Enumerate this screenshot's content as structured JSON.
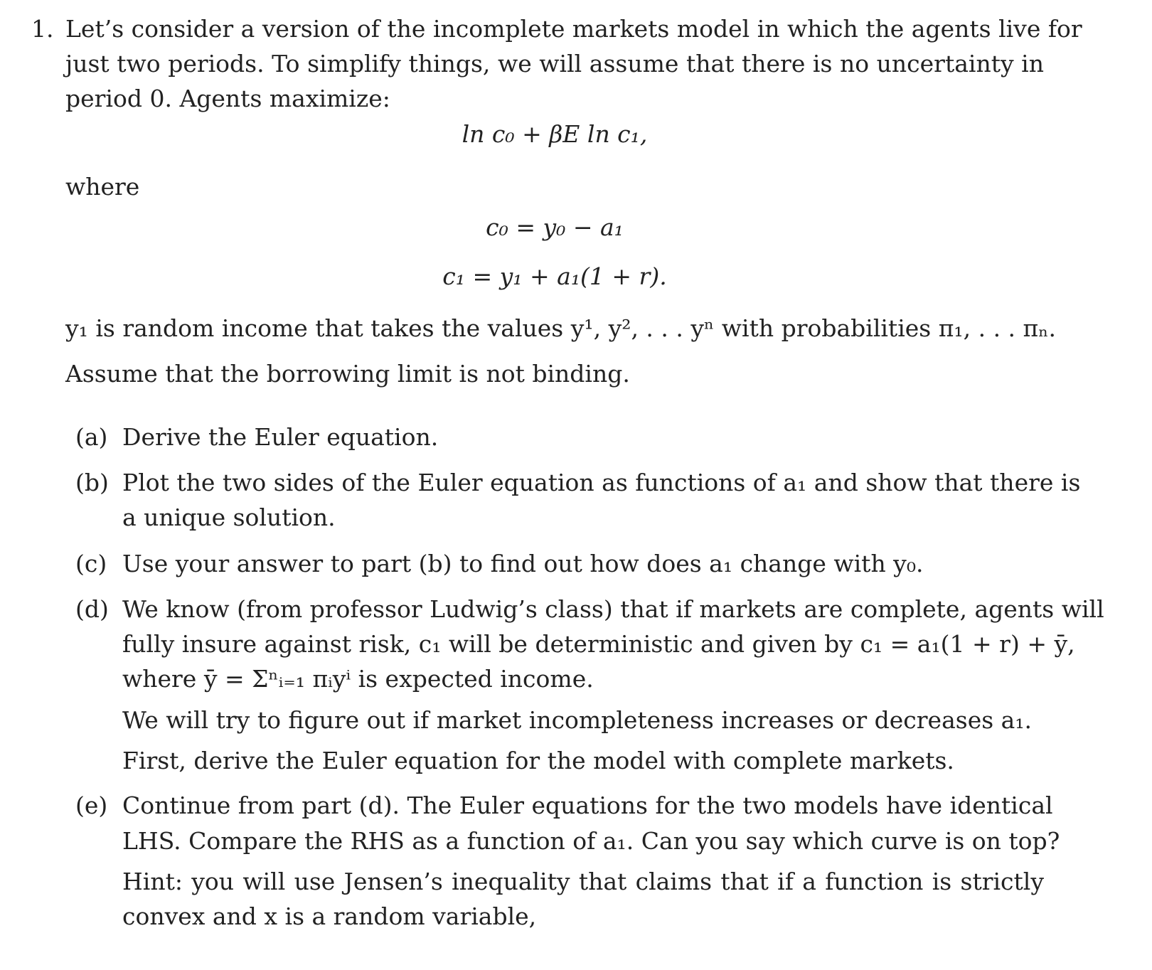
{
  "problem": {
    "number": "1.",
    "intro_lines": [
      "Let’s consider a version of the incomplete markets model in which the agents live for",
      "just two periods. To simplify things, we will assume that there is no uncertainty in",
      "period 0. Agents maximize:"
    ],
    "objective": "ln c₀ + βE ln c₁,",
    "where_label": "where",
    "constraint_1": "c₀ = y₀ − a₁",
    "constraint_2": "c₁ = y₁ + a₁(1 + r).",
    "income_line": "y₁ is random income that takes the values y¹, y², . . . yⁿ with probabilities π₁, . . . πₙ.",
    "assumption_line": "Assume that the borrowing limit is not binding."
  },
  "parts": [
    {
      "label": "(a)",
      "lines": [
        "Derive the Euler equation."
      ]
    },
    {
      "label": "(b)",
      "lines": [
        "Plot the two sides of the Euler equation as functions of a₁ and show that there is",
        "a unique solution."
      ]
    },
    {
      "label": "(c)",
      "lines": [
        "Use your answer to part (b) to find out how does a₁ change with y₀."
      ]
    },
    {
      "label": "(d)",
      "lines": [
        "We know (from professor Ludwig’s class) that if markets are complete, agents will",
        "fully insure against risk, c₁ will be deterministic and given by c₁ = a₁(1 + r) + ȳ,",
        "where ȳ = Σⁿᵢ₌₁ πᵢyⁱ is expected income.",
        "We will try to figure out if market incompleteness increases or decreases a₁.",
        "First, derive the Euler equation for the model with complete markets."
      ]
    },
    {
      "label": "(e)",
      "lines": [
        "Continue from part (d). The Euler equations for the two models have identical",
        "LHS. Compare the RHS as a function of a₁. Can you say which curve is on top?",
        "Hint: you will use Jensen’s inequality that claims that if a function is strictly",
        "convex and x is a random variable,"
      ]
    }
  ]
}
